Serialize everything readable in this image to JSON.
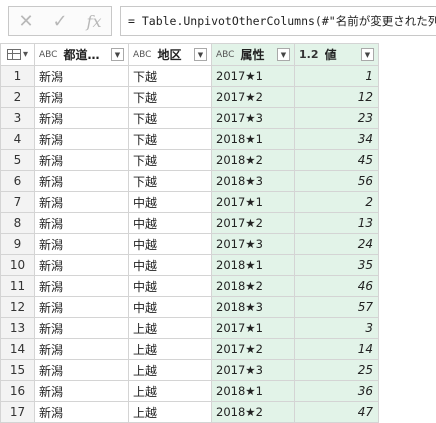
{
  "formula_bar": {
    "cancel_icon": "✕",
    "confirm_icon": "✓",
    "fx_label": "fx",
    "formula": "= Table.UnpivotOtherColumns(#\"名前が変更された列"
  },
  "table": {
    "headers": {
      "prefecture": "都道府…",
      "district": "地区",
      "attribute": "属性",
      "value": "値"
    },
    "type_icons": {
      "text": "ABC",
      "number": "1.2"
    },
    "rows": [
      {
        "idx": "1",
        "pref": "新潟",
        "dist": "下越",
        "attr": "2017★1",
        "val": "1"
      },
      {
        "idx": "2",
        "pref": "新潟",
        "dist": "下越",
        "attr": "2017★2",
        "val": "12"
      },
      {
        "idx": "3",
        "pref": "新潟",
        "dist": "下越",
        "attr": "2017★3",
        "val": "23"
      },
      {
        "idx": "4",
        "pref": "新潟",
        "dist": "下越",
        "attr": "2018★1",
        "val": "34"
      },
      {
        "idx": "5",
        "pref": "新潟",
        "dist": "下越",
        "attr": "2018★2",
        "val": "45"
      },
      {
        "idx": "6",
        "pref": "新潟",
        "dist": "下越",
        "attr": "2018★3",
        "val": "56"
      },
      {
        "idx": "7",
        "pref": "新潟",
        "dist": "中越",
        "attr": "2017★1",
        "val": "2"
      },
      {
        "idx": "8",
        "pref": "新潟",
        "dist": "中越",
        "attr": "2017★2",
        "val": "13"
      },
      {
        "idx": "9",
        "pref": "新潟",
        "dist": "中越",
        "attr": "2017★3",
        "val": "24"
      },
      {
        "idx": "10",
        "pref": "新潟",
        "dist": "中越",
        "attr": "2018★1",
        "val": "35"
      },
      {
        "idx": "11",
        "pref": "新潟",
        "dist": "中越",
        "attr": "2018★2",
        "val": "46"
      },
      {
        "idx": "12",
        "pref": "新潟",
        "dist": "中越",
        "attr": "2018★3",
        "val": "57"
      },
      {
        "idx": "13",
        "pref": "新潟",
        "dist": "上越",
        "attr": "2017★1",
        "val": "3"
      },
      {
        "idx": "14",
        "pref": "新潟",
        "dist": "上越",
        "attr": "2017★2",
        "val": "14"
      },
      {
        "idx": "15",
        "pref": "新潟",
        "dist": "上越",
        "attr": "2017★3",
        "val": "25"
      },
      {
        "idx": "16",
        "pref": "新潟",
        "dist": "上越",
        "attr": "2018★1",
        "val": "36"
      },
      {
        "idx": "17",
        "pref": "新潟",
        "dist": "上越",
        "attr": "2018★2",
        "val": "47"
      }
    ]
  }
}
